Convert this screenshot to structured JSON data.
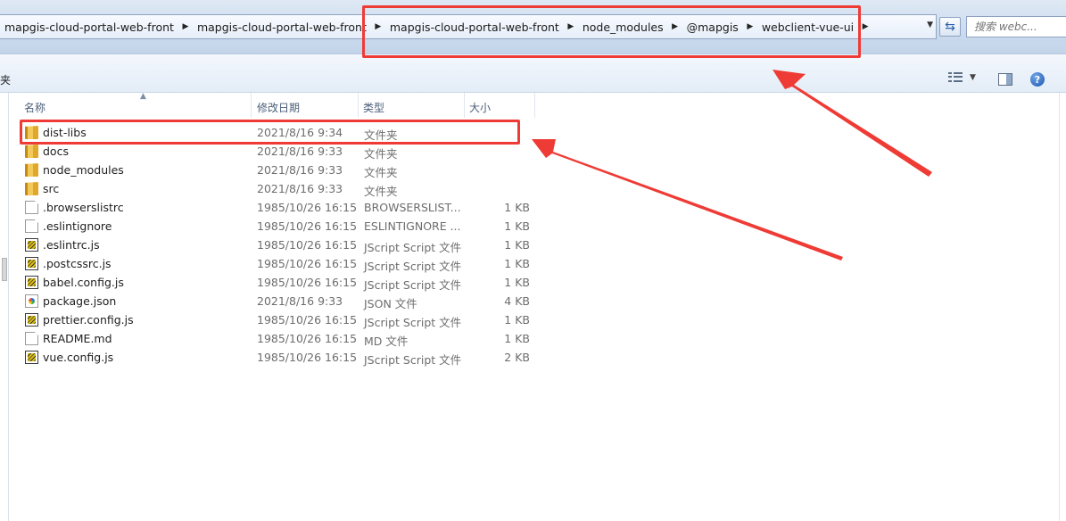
{
  "address": {
    "crumbs": [
      "mapgis-cloud-portal-web-front",
      "mapgis-cloud-portal-web-front",
      "mapgis-cloud-portal-web-front",
      "node_modules",
      "@mapgis",
      "webclient-vue-ui"
    ],
    "search_placeholder": "搜索 webc..."
  },
  "toolbar": {
    "label": "夹"
  },
  "columns": {
    "name": "名称",
    "date": "修改日期",
    "type": "类型",
    "size": "大小"
  },
  "files": [
    {
      "name": "dist-libs",
      "date": "2021/8/16 9:34",
      "type": "文件夹",
      "size": "",
      "icon": "folder-icon"
    },
    {
      "name": "docs",
      "date": "2021/8/16 9:33",
      "type": "文件夹",
      "size": "",
      "icon": "folder-icon"
    },
    {
      "name": "node_modules",
      "date": "2021/8/16 9:33",
      "type": "文件夹",
      "size": "",
      "icon": "folder-icon"
    },
    {
      "name": "src",
      "date": "2021/8/16 9:33",
      "type": "文件夹",
      "size": "",
      "icon": "folder-icon"
    },
    {
      "name": ".browserslistrc",
      "date": "1985/10/26 16:15",
      "type": "BROWSERSLIST...",
      "size": "1 KB",
      "icon": "document-icon"
    },
    {
      "name": ".eslintignore",
      "date": "1985/10/26 16:15",
      "type": "ESLINTIGNORE ...",
      "size": "1 KB",
      "icon": "document-icon"
    },
    {
      "name": ".eslintrc.js",
      "date": "1985/10/26 16:15",
      "type": "JScript Script 文件",
      "size": "1 KB",
      "icon": "script-icon"
    },
    {
      "name": ".postcssrc.js",
      "date": "1985/10/26 16:15",
      "type": "JScript Script 文件",
      "size": "1 KB",
      "icon": "script-icon"
    },
    {
      "name": "babel.config.js",
      "date": "1985/10/26 16:15",
      "type": "JScript Script 文件",
      "size": "1 KB",
      "icon": "script-icon"
    },
    {
      "name": "package.json",
      "date": "2021/8/16 9:33",
      "type": "JSON 文件",
      "size": "4 KB",
      "icon": "json-icon"
    },
    {
      "name": "prettier.config.js",
      "date": "1985/10/26 16:15",
      "type": "JScript Script 文件",
      "size": "1 KB",
      "icon": "script-icon"
    },
    {
      "name": "README.md",
      "date": "1985/10/26 16:15",
      "type": "MD 文件",
      "size": "1 KB",
      "icon": "document-icon"
    },
    {
      "name": "vue.config.js",
      "date": "1985/10/26 16:15",
      "type": "JScript Script 文件",
      "size": "2 KB",
      "icon": "script-icon"
    }
  ],
  "colors": {
    "annotation_red": "#ef3b35",
    "toolbar_blue": "#cddcee"
  }
}
